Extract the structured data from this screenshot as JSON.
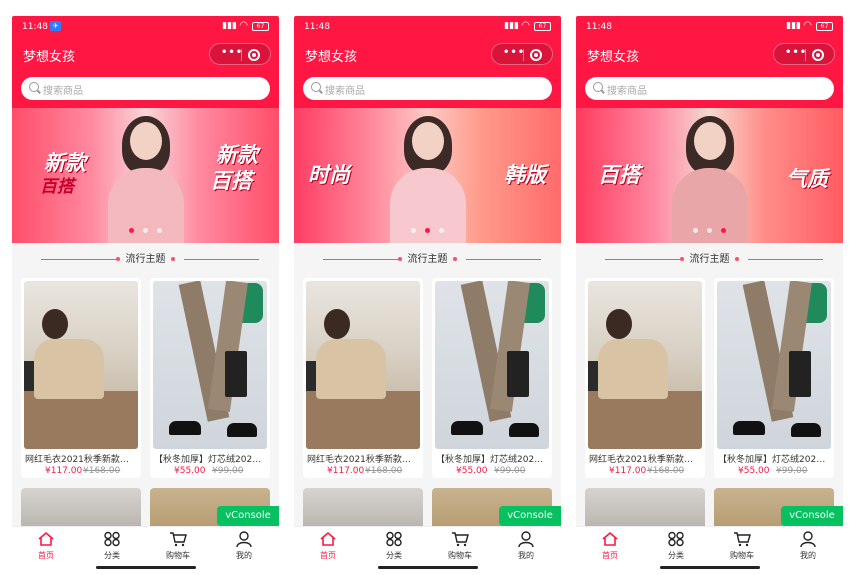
{
  "status": {
    "time": "11:48",
    "battery": "67"
  },
  "app": {
    "title": "梦想女孩"
  },
  "capsule": {
    "more_label": "•••"
  },
  "search": {
    "placeholder": "搜索商品"
  },
  "banners": [
    {
      "left_text_1": "新款",
      "left_text_2": "百搭",
      "right_text_1": "新款",
      "right_text_2": "百搭"
    },
    {
      "left_text_1": "时尚",
      "left_text_2": "",
      "right_text_1": "韩版",
      "right_text_2": ""
    },
    {
      "left_text_1": "百搭",
      "left_text_2": "",
      "right_text_1": "气质",
      "right_text_2": ""
    }
  ],
  "section": {
    "title": "流行主题"
  },
  "products": [
    {
      "name": "网红毛衣2021秋季新款百...",
      "price": "¥117.00",
      "old_price": "¥168.00"
    },
    {
      "name": "【秋冬加厚】灯芯绒2021新...",
      "price": "¥55.00",
      "old_price": "¥99.00"
    }
  ],
  "vconsole": {
    "label": "vConsole"
  },
  "tabbar": {
    "items": [
      {
        "label": "首页",
        "icon": "home-icon"
      },
      {
        "label": "分类",
        "icon": "category-icon"
      },
      {
        "label": "购物车",
        "icon": "cart-icon"
      },
      {
        "label": "我的",
        "icon": "user-icon"
      }
    ]
  },
  "colors": {
    "brand": "#ff1744",
    "vconsole": "#07c160"
  }
}
